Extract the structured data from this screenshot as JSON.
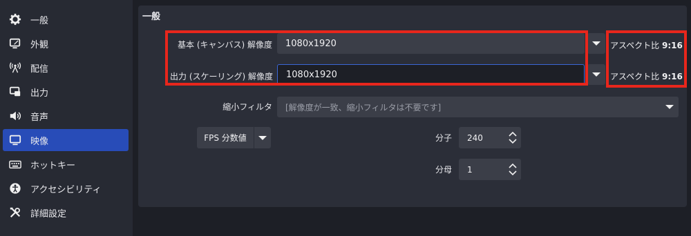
{
  "sidebar": {
    "items": [
      {
        "label": "一般",
        "icon": "gear-icon"
      },
      {
        "label": "外観",
        "icon": "appearance-icon"
      },
      {
        "label": "配信",
        "icon": "broadcast-icon"
      },
      {
        "label": "出力",
        "icon": "output-icon"
      },
      {
        "label": "音声",
        "icon": "speaker-icon"
      },
      {
        "label": "映像",
        "icon": "monitor-icon",
        "active": true
      },
      {
        "label": "ホットキー",
        "icon": "keyboard-icon"
      },
      {
        "label": "アクセシビリティ",
        "icon": "accessibility-icon"
      },
      {
        "label": "詳細設定",
        "icon": "tools-icon"
      }
    ]
  },
  "panel": {
    "title": "一般",
    "base_resolution": {
      "label": "基本 (キャンバス) 解像度",
      "value": "1080x1920",
      "aspect_prefix": "アスペクト比",
      "aspect_value": "9:16"
    },
    "output_resolution": {
      "label": "出力 (スケーリング) 解像度",
      "value": "1080x1920",
      "aspect_prefix": "アスペクト比",
      "aspect_value": "9:16"
    },
    "downscale_filter": {
      "label": "縮小フィルタ",
      "placeholder": "[解像度が一致、縮小フィルタは不要です]"
    },
    "fps": {
      "button_label": "FPS 分数値",
      "numerator_label": "分子",
      "numerator_value": "240",
      "denominator_label": "分母",
      "denominator_value": "1"
    }
  },
  "colors": {
    "accent": "#284cb8",
    "highlight": "#e8261c",
    "panel": "#2b2e38",
    "field": "#3b3e48"
  }
}
